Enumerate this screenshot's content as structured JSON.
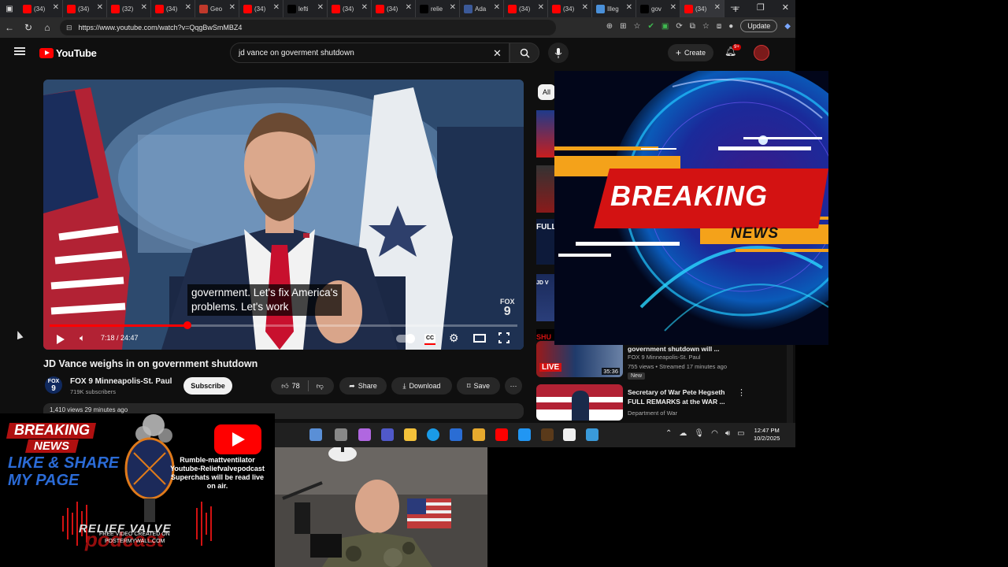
{
  "browser": {
    "tabs": [
      {
        "title": "(34)",
        "color": "#ff0000"
      },
      {
        "title": "(34)",
        "color": "#ff0000"
      },
      {
        "title": "(32)",
        "color": "#ff0000"
      },
      {
        "title": "(34)",
        "color": "#ff0000"
      },
      {
        "title": "Geo",
        "color": "#c0392b"
      },
      {
        "title": "(34)",
        "color": "#ff0000"
      },
      {
        "title": "lefti",
        "color": "#000000"
      },
      {
        "title": "(34)",
        "color": "#ff0000"
      },
      {
        "title": "(34)",
        "color": "#ff0000"
      },
      {
        "title": "relie",
        "color": "#000000"
      },
      {
        "title": "Ada",
        "color": "#3b5998"
      },
      {
        "title": "(34)",
        "color": "#ff0000"
      },
      {
        "title": "(34)",
        "color": "#ff0000"
      },
      {
        "title": "Illeg",
        "color": "#4a90d9"
      },
      {
        "title": "gov",
        "color": "#000000"
      },
      {
        "title": "(34)",
        "color": "#ff0000"
      }
    ],
    "url": "https://www.youtube.com/watch?v=QqgBwSmMBZ4",
    "update_label": "Update"
  },
  "youtube": {
    "logo_text": "YouTube",
    "search_query": "jd vance on goverment shutdown",
    "create_label": "Create",
    "notification_count": "9+",
    "player": {
      "caption_line1": "government. Let's fix America's",
      "caption_line2": "problems. Let's work",
      "bug_text": "FOX",
      "bug_number": "9",
      "time": "7:18 / 24:47",
      "progress_fraction": 0.294,
      "cc_label": "CC"
    },
    "video_title": "JD Vance weighs in on government shutdown",
    "channel": {
      "avatar_text": "FOX",
      "avatar_number": "9",
      "name": "FOX 9 Minneapolis-St. Paul",
      "subscribers": "719K subscribers"
    },
    "subscribe_label": "Subscribe",
    "like_count": "78",
    "share_label": "Share",
    "download_label": "Download",
    "save_label": "Save",
    "description_preview": "1,410 views  29 minutes ago",
    "chip_all": "All",
    "recommendations": [
      {
        "title": "government shutdown will ...",
        "channel": "FOX 9 Minneapolis-St. Paul",
        "meta": "755 views • Streamed 17 minutes ago",
        "badge": "New",
        "duration": "35:36",
        "thumb_text": "LIVE"
      },
      {
        "title": "Secretary of War Pete Hegseth FULL REMARKS at the WAR ...",
        "channel": "Department of War",
        "meta": "",
        "badge": "",
        "duration": "",
        "thumb_text": ""
      }
    ],
    "sidebar_thumb_labels": [
      "FULL",
      "JD V",
      "SHU"
    ]
  },
  "taskbar": {
    "clock_time": "12:47 PM",
    "clock_date": "10/2/2025"
  },
  "breaking_overlay": {
    "title": "BREAKING",
    "subtitle": "NEWS",
    "accent_red": "#d31212",
    "accent_orange": "#f4a21a"
  },
  "promo": {
    "breaking_word": "BREAKING",
    "news_word": "NEWS",
    "like_share": "LIKE & SHARE MY PAGE",
    "info_lines": [
      "Rumble-mattventilator",
      "Youtube-Reliefvalvepodcast",
      "Superchats will be read live",
      "on air."
    ],
    "relief_valve": "RELIEF VALVE",
    "credit_line1": "FREE VIDEO CREATED ON",
    "credit_line2": "POSTERMYWALL.COM",
    "podcast_word": "podcast"
  }
}
